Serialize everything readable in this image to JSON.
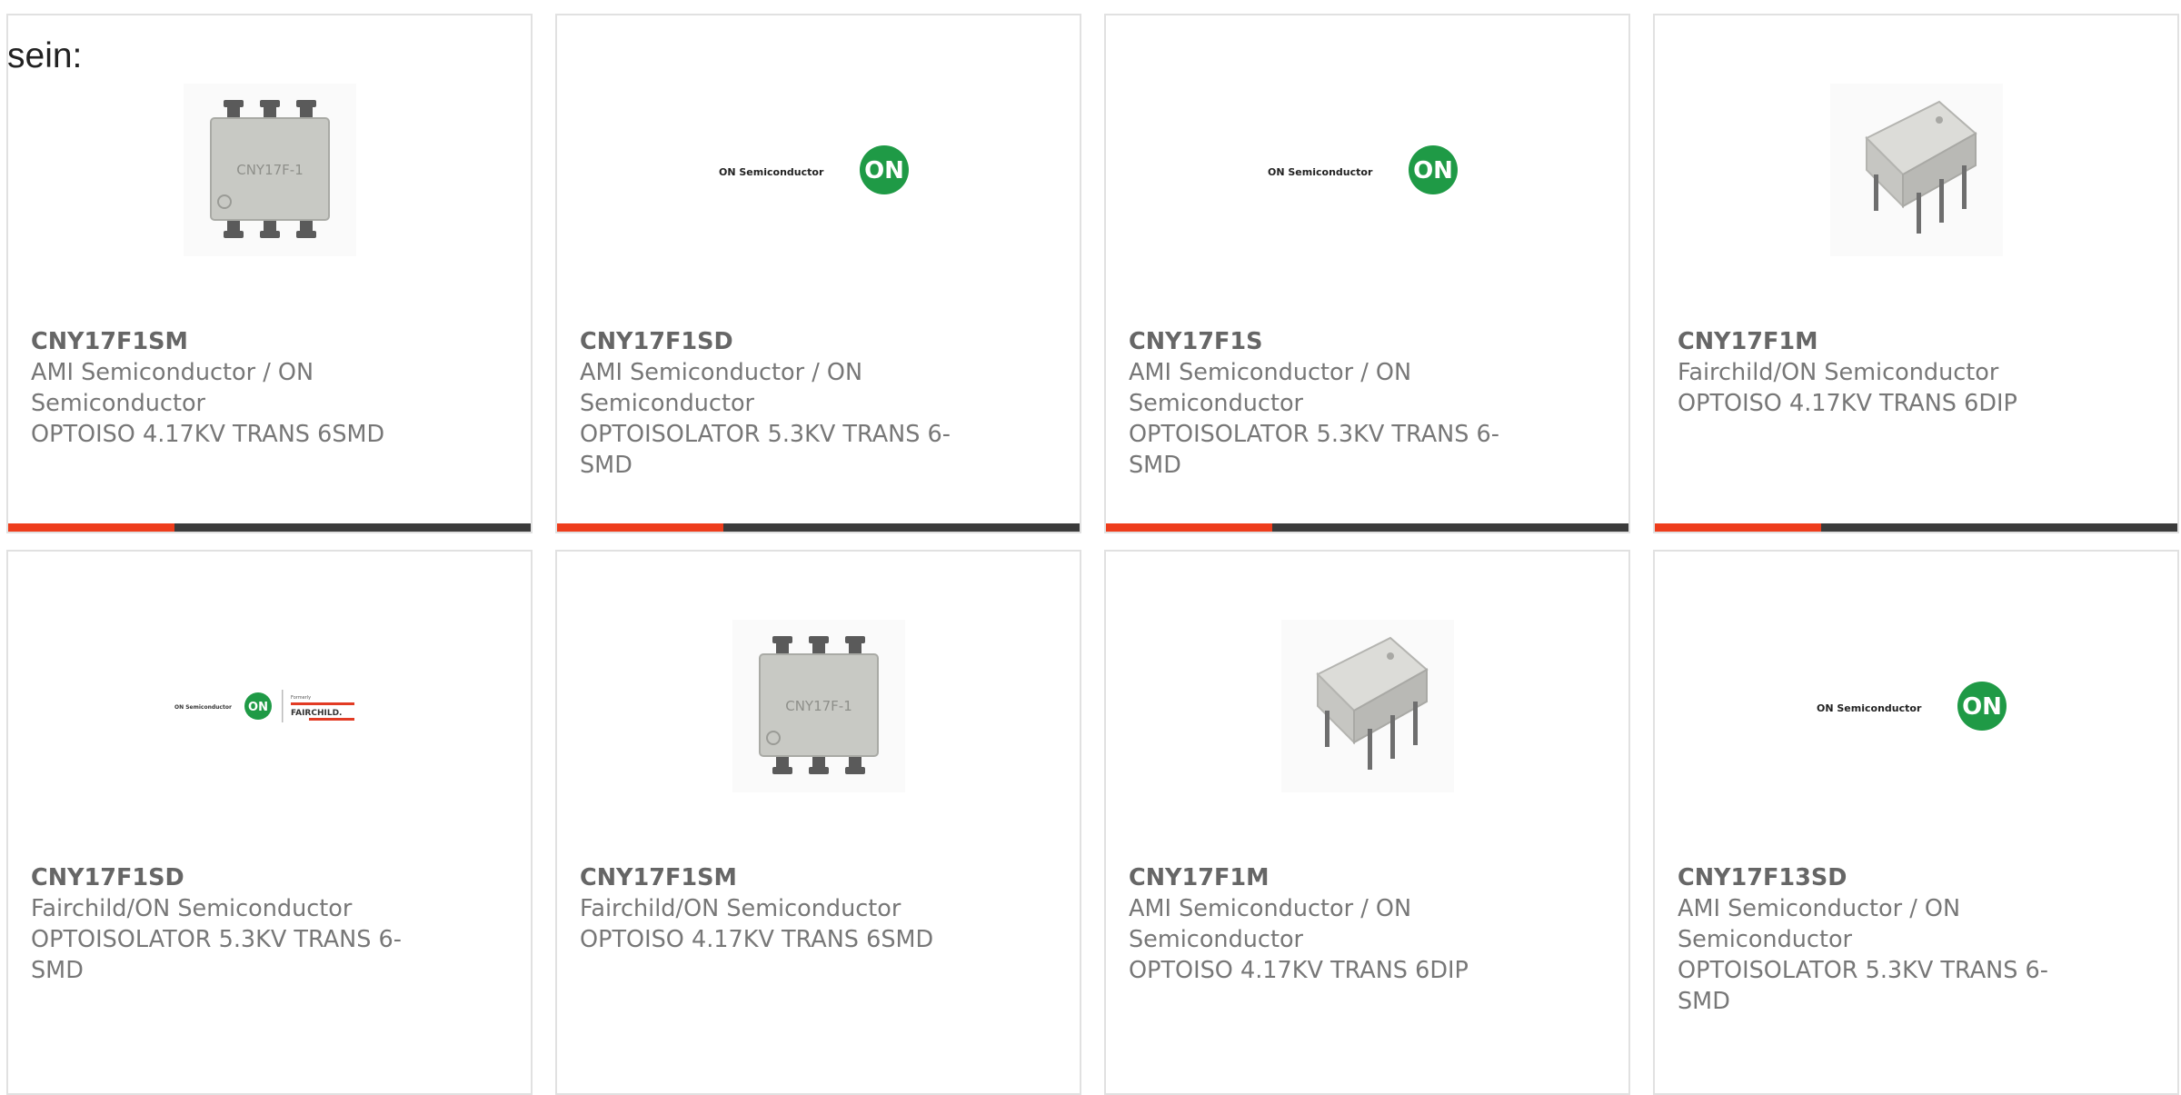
{
  "lead_text": "sein:",
  "products": [
    {
      "part": "CNY17F1SM",
      "manufacturer": "AMI Semiconductor / ON Semiconductor",
      "description": "OPTOISO 4.17KV TRANS 6SMD",
      "image": "smd-chip-image",
      "chip_marking": "CNY17F-1"
    },
    {
      "part": "CNY17F1SD",
      "manufacturer": "AMI Semiconductor / ON Semiconductor",
      "description": "OPTOISOLATOR 5.3KV TRANS 6-SMD",
      "image": "on-semiconductor-logo",
      "logo_text": "ON Semiconductor",
      "logo_mark": "ON"
    },
    {
      "part": "CNY17F1S",
      "manufacturer": "AMI Semiconductor / ON Semiconductor",
      "description": "OPTOISOLATOR 5.3KV TRANS 6-SMD",
      "image": "on-semiconductor-logo",
      "logo_text": "ON Semiconductor",
      "logo_mark": "ON"
    },
    {
      "part": "CNY17F1M",
      "manufacturer": "Fairchild/ON Semiconductor",
      "description": "OPTOISO 4.17KV TRANS 6DIP",
      "image": "dip-chip-image"
    },
    {
      "part": "CNY17F1SD",
      "manufacturer": "Fairchild/ON Semiconductor",
      "description": "OPTOISOLATOR 5.3KV TRANS 6-SMD",
      "image": "on-fairchild-logo",
      "logo_text": "ON Semiconductor",
      "logo_mark": "ON",
      "logo_formerly": "Formerly",
      "logo_fairchild": "FAIRCHILD."
    },
    {
      "part": "CNY17F1SM",
      "manufacturer": "Fairchild/ON Semiconductor",
      "description": "OPTOISO 4.17KV TRANS 6SMD",
      "image": "smd-chip-image",
      "chip_marking": "CNY17F-1"
    },
    {
      "part": "CNY17F1M",
      "manufacturer": "AMI Semiconductor / ON Semiconductor",
      "description": "OPTOISO 4.17KV TRANS 6DIP",
      "image": "dip-chip-image"
    },
    {
      "part": "CNY17F13SD",
      "manufacturer": "AMI Semiconductor / ON Semiconductor",
      "description": "OPTOISOLATOR 5.3KV TRANS 6-SMD",
      "image": "on-semiconductor-logo",
      "logo_text": "ON Semiconductor",
      "logo_mark": "ON"
    }
  ],
  "colors": {
    "accent": "#ee3d1c",
    "bar": "#3b3b3b",
    "border": "#e1e1e1",
    "text": "#777777",
    "on_green": "#1f9a46"
  }
}
